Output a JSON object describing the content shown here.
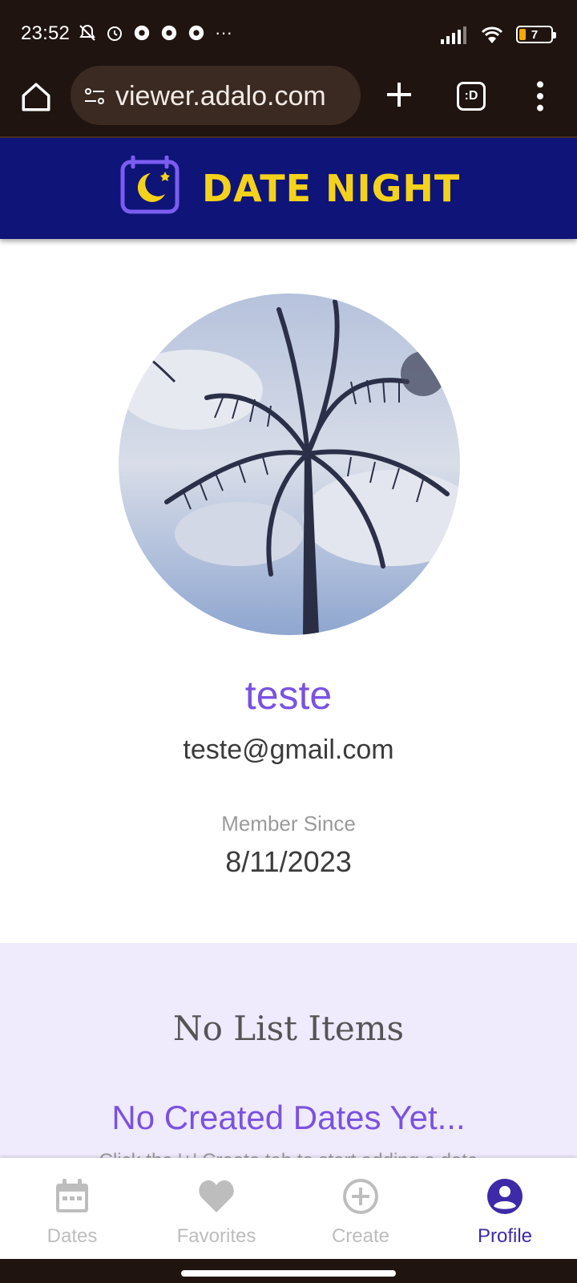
{
  "status_bar": {
    "time": "23:52",
    "battery_level": "7",
    "left_icons": [
      "notifications-off-icon",
      "alarm-icon",
      "chrome-icon",
      "chrome-icon",
      "chrome-icon",
      "more-dots-icon"
    ],
    "more_indicator": "···"
  },
  "browser": {
    "url": "viewer.adalo.com",
    "tab_count_label": ":D"
  },
  "app_header": {
    "title": "DATE NIGHT",
    "brand_color": "#0f1478",
    "accent_color": "#f4d21b"
  },
  "profile": {
    "name": "teste",
    "email": "teste@gmail.com",
    "member_since_label": "Member Since",
    "member_since_date": "8/11/2023"
  },
  "created_dates": {
    "empty_list_text": "No List Items",
    "empty_title": "No Created Dates Yet...",
    "cutoff_text": "Click the '+' Create tab to start adding a date"
  },
  "bottom_nav": {
    "items": [
      {
        "label": "Dates",
        "icon": "calendar-icon",
        "active": false
      },
      {
        "label": "Favorites",
        "icon": "heart-icon",
        "active": false
      },
      {
        "label": "Create",
        "icon": "plus-circle-icon",
        "active": false
      },
      {
        "label": "Profile",
        "icon": "account-circle-icon",
        "active": true
      }
    ],
    "active_color": "#3d2aa8",
    "inactive_color": "#bdbdbd"
  }
}
